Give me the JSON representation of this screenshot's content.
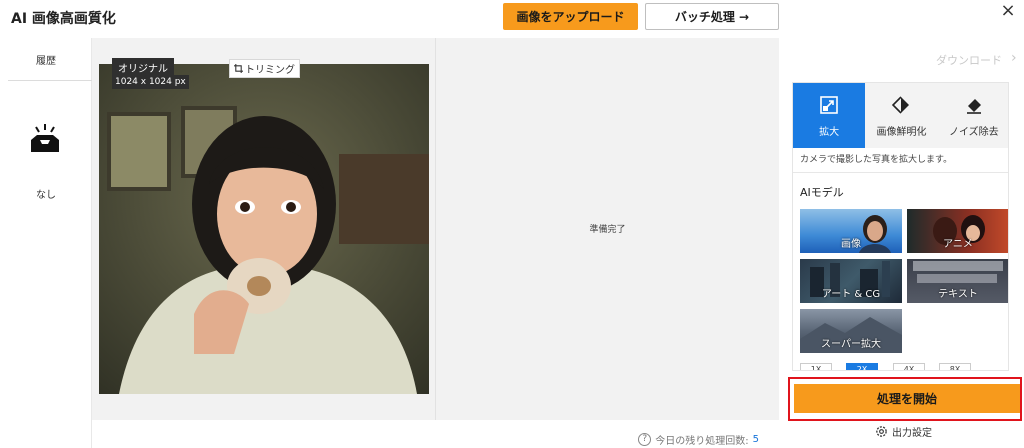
{
  "header": {
    "title": "AI 画像高画質化",
    "upload_button": "画像をアップロード",
    "batch_button": "バッチ処理 →",
    "close_icon": "×"
  },
  "sidebar": {
    "history_label": "履歴",
    "empty_label": "なし"
  },
  "workspace": {
    "original_tag": "オリジナル",
    "size_tag": "1024 x 1024 px",
    "trim_button": "トリミング",
    "ready_text": "準備完了",
    "remaining_label": "今日の残り処理回数:",
    "remaining_count": "5"
  },
  "panel": {
    "download_link": "ダウンロード",
    "tabs": [
      {
        "label": "拡大",
        "icon": "enlarge-icon",
        "active": true
      },
      {
        "label": "画像鮮明化",
        "icon": "sharpen-icon",
        "active": false
      },
      {
        "label": "ノイズ除去",
        "icon": "eraser-icon",
        "active": false
      }
    ],
    "description": "カメラで撮影した写真を拡大します。",
    "ai_model_title": "AIモデル",
    "models": [
      "画像",
      "アニメ",
      "アート & CG",
      "テキスト",
      "スーパー拡大"
    ],
    "scales": [
      "1X",
      "2X",
      "4X",
      "8X"
    ],
    "active_scale": "2X",
    "start_button": "処理を開始",
    "output_settings": "出力設定"
  },
  "colors": {
    "accent_orange": "#f79a1c",
    "accent_blue": "#1a7be2",
    "highlight_red": "#e0141c"
  }
}
